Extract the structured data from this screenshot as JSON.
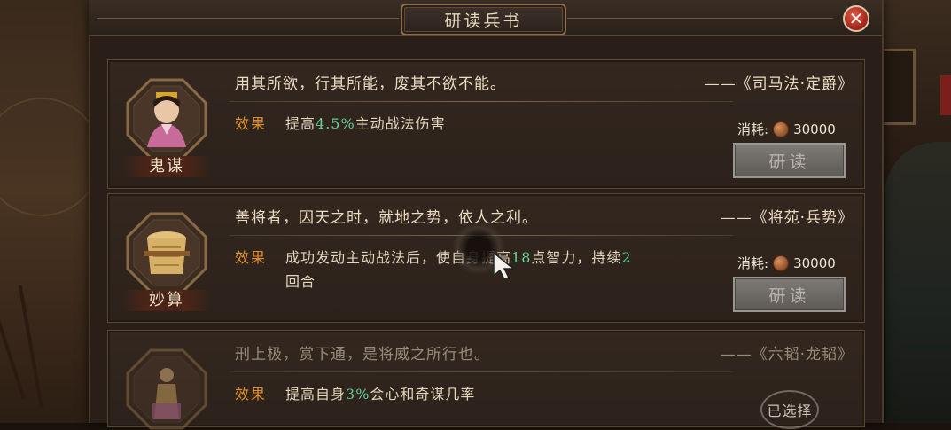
{
  "window": {
    "title": "研读兵书"
  },
  "close_symbol": "✕",
  "cards": [
    {
      "name": "鬼谋",
      "quote": "用其所欲，行其所能，废其不欲不能。",
      "source": "——《司马法·定爵》",
      "effect_label": "效果",
      "effect_pre": "提高",
      "effect_hl": "4.5%",
      "effect_post": "主动战法伤害",
      "effect_hl2": "",
      "effect_post2": "",
      "cost_label": "消耗:",
      "cost_value": "30000",
      "button_label": "研读",
      "portrait_icon": "female-strategist-portrait-icon"
    },
    {
      "name": "妙算",
      "quote": "善将者，因天之时，就地之势，依人之利。",
      "source": "——《将苑·兵势》",
      "effect_label": "效果",
      "effect_pre": "成功发动主动战法后，使自身提高",
      "effect_hl": "18",
      "effect_post": "点智力，持续",
      "effect_hl2": "2",
      "effect_post2": "回合",
      "cost_label": "消耗:",
      "cost_value": "30000",
      "button_label": "研读",
      "portrait_icon": "scroll-bundle-icon"
    },
    {
      "name": "",
      "quote": "刑上极，赏下通，是将威之所行也。",
      "source": "——《六韬·龙韬》",
      "effect_label": "效果",
      "effect_pre": "提高自身",
      "effect_hl": "3%",
      "effect_post": "会心和奇谋几率",
      "effect_hl2": "",
      "effect_post2": "",
      "status_badge": "已选择",
      "portrait_icon": "standing-figure-icon"
    }
  ],
  "colors": {
    "highlight": "#5fd19c",
    "effect_label": "#e0902e",
    "panel_bg": "#2a1f18",
    "close_red": "#c0392b"
  }
}
